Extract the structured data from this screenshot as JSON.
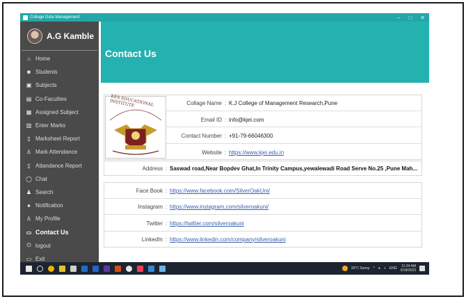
{
  "window": {
    "title": "Collage Data Management",
    "minimize": "–",
    "maximize": "□",
    "close": "✕"
  },
  "profile": {
    "name": "A.G Kamble"
  },
  "sidebar": {
    "items": [
      {
        "label": "Home",
        "icon": "home-icon",
        "glyph": "⌂"
      },
      {
        "label": "Students",
        "icon": "students-icon",
        "glyph": "☻"
      },
      {
        "label": "Subjects",
        "icon": "subjects-icon",
        "glyph": "▣"
      },
      {
        "label": "Co-Faculties",
        "icon": "faculties-icon",
        "glyph": "▤"
      },
      {
        "label": "Assigned Subject",
        "icon": "assigned-icon",
        "glyph": "▦"
      },
      {
        "label": "Enter Marks",
        "icon": "marks-icon",
        "glyph": "▥"
      },
      {
        "label": "Marksheet Report",
        "icon": "report-icon",
        "glyph": "▯"
      },
      {
        "label": "Mark Attendance",
        "icon": "attendance-icon",
        "glyph": "♙"
      },
      {
        "label": "Attandance Report",
        "icon": "attendance-report-icon",
        "glyph": "▯"
      },
      {
        "label": "Chat",
        "icon": "chat-icon",
        "glyph": "◯"
      },
      {
        "label": "Search",
        "icon": "search-icon",
        "glyph": "♟"
      },
      {
        "label": "Notification",
        "icon": "bell-icon",
        "glyph": "♠"
      },
      {
        "label": "My Profile",
        "icon": "profile-icon",
        "glyph": "♙"
      },
      {
        "label": "Contact Us",
        "icon": "contact-icon",
        "glyph": "▭",
        "active": true
      },
      {
        "label": "logout",
        "icon": "logout-icon",
        "glyph": "⏻"
      },
      {
        "label": "Exit",
        "icon": "exit-icon",
        "glyph": "▭"
      }
    ]
  },
  "header": {
    "title": "Contact Us"
  },
  "logo": {
    "arc_text": "KES EDUCATIONAL INSTITUTE"
  },
  "info": {
    "college_label": "Collage Name",
    "college_value": "K.J College of Management Research,Pune",
    "email_label": "Email ID",
    "email_value": "info@kjei.com",
    "phone_label": "Contact Number",
    "phone_value": "+91-79-66046300",
    "website_label": "Website",
    "website_value": "https://www.kjei.edu.in"
  },
  "address": {
    "label": "Address",
    "value": "Saswad road,Near Bopdev Ghat,In Trinity Campus,yewalewadi Road Serve No.25 ,Pune Mah..."
  },
  "social": {
    "facebook_label": "Face Book",
    "facebook_value": "https://www.facebook.com/SilverOakUni/",
    "instagram_label": "Instagram",
    "instagram_value": "https://www.instagram.com/silveroakuni/",
    "twitter_label": "Twitter",
    "twitter_value": "https://twitter.com/silveroakuni",
    "linkedin_label": "LinkedIn",
    "linkedin_value": "https://www.linkedin.com/company/silveroakuni"
  },
  "colon": ":",
  "taskbar": {
    "weather": "33°C Sunny",
    "lang": "ENG",
    "time": "11:24 AM",
    "date": "5/18/2023"
  },
  "colors": {
    "accent": "#23b2b0",
    "sidebar": "#4a4a4a",
    "link": "#3a5fb0"
  }
}
